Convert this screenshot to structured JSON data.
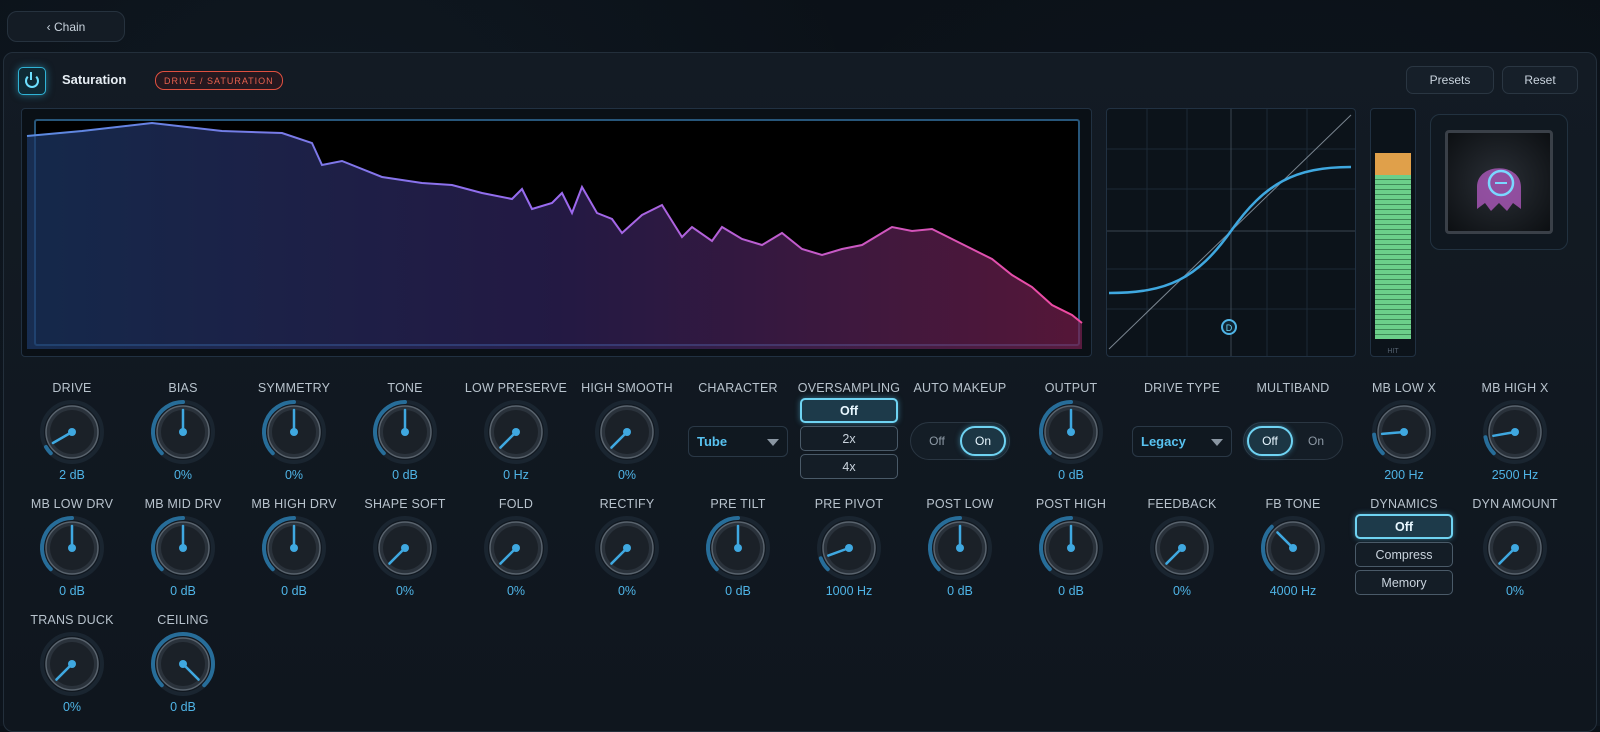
{
  "nav": {
    "back_label": "‹ Chain"
  },
  "header": {
    "title": "Saturation",
    "badge": "DRIVE / SATURATION",
    "presets_label": "Presets",
    "reset_label": "Reset"
  },
  "colors": {
    "accent": "#4fb4e6",
    "active": "#6fd3f2",
    "badge": "#e8624f",
    "meter_green": "#6ccf8a",
    "meter_orange": "#e0a04a"
  },
  "meter": {
    "green_level": 0.74,
    "orange_level": 0.84,
    "label": "HIT"
  },
  "row1": [
    {
      "label": "DRIVE",
      "value": "2 dB",
      "angle": -120
    },
    {
      "label": "BIAS",
      "value": "0%",
      "angle": 0
    },
    {
      "label": "SYMMETRY",
      "value": "0%",
      "angle": 0
    },
    {
      "label": "TONE",
      "value": "0 dB",
      "angle": 0
    },
    {
      "label": "LOW PRESERVE",
      "value": "0 Hz",
      "angle": -135
    },
    {
      "label": "HIGH SMOOTH",
      "value": "0%",
      "angle": -135
    }
  ],
  "character": {
    "label": "CHARACTER",
    "selected": "Tube"
  },
  "oversampling": {
    "label": "OVERSAMPLING",
    "options": [
      "Off",
      "2x",
      "4x"
    ],
    "selected": 0
  },
  "auto_makeup": {
    "label": "AUTO MAKEUP",
    "off": "Off",
    "on": "On",
    "selected": "On"
  },
  "output": {
    "label": "OUTPUT",
    "value": "0 dB",
    "angle": 0
  },
  "drive_type": {
    "label": "DRIVE TYPE",
    "selected": "Legacy"
  },
  "multiband": {
    "label": "MULTIBAND",
    "off": "Off",
    "on": "On",
    "selected": "Off"
  },
  "mb_low_x": {
    "label": "MB LOW X",
    "value": "200 Hz",
    "angle": -95
  },
  "mb_high_x": {
    "label": "MB HIGH X",
    "value": "2500 Hz",
    "angle": -100
  },
  "row2": [
    {
      "label": "MB LOW DRV",
      "value": "0 dB",
      "angle": 0
    },
    {
      "label": "MB MID DRV",
      "value": "0 dB",
      "angle": 0
    },
    {
      "label": "MB HIGH DRV",
      "value": "0 dB",
      "angle": 0
    },
    {
      "label": "SHAPE SOFT",
      "value": "0%",
      "angle": -135
    },
    {
      "label": "FOLD",
      "value": "0%",
      "angle": -135
    },
    {
      "label": "RECTIFY",
      "value": "0%",
      "angle": -135
    },
    {
      "label": "PRE TILT",
      "value": "0 dB",
      "angle": 0
    },
    {
      "label": "PRE PIVOT",
      "value": "1000 Hz",
      "angle": -110
    },
    {
      "label": "POST LOW",
      "value": "0 dB",
      "angle": 0
    },
    {
      "label": "POST HIGH",
      "value": "0 dB",
      "angle": 0
    },
    {
      "label": "FEEDBACK",
      "value": "0%",
      "angle": -135
    },
    {
      "label": "FB TONE",
      "value": "4000 Hz",
      "angle": -45
    }
  ],
  "dynamics": {
    "label": "DYNAMICS",
    "options": [
      "Off",
      "Compress",
      "Memory"
    ],
    "selected": 0
  },
  "dyn_amount": {
    "label": "DYN AMOUNT",
    "value": "0%",
    "angle": -135
  },
  "row3": [
    {
      "label": "TRANS DUCK",
      "value": "0%",
      "angle": -135
    },
    {
      "label": "CEILING",
      "value": "0 dB",
      "angle": 135
    }
  ]
}
